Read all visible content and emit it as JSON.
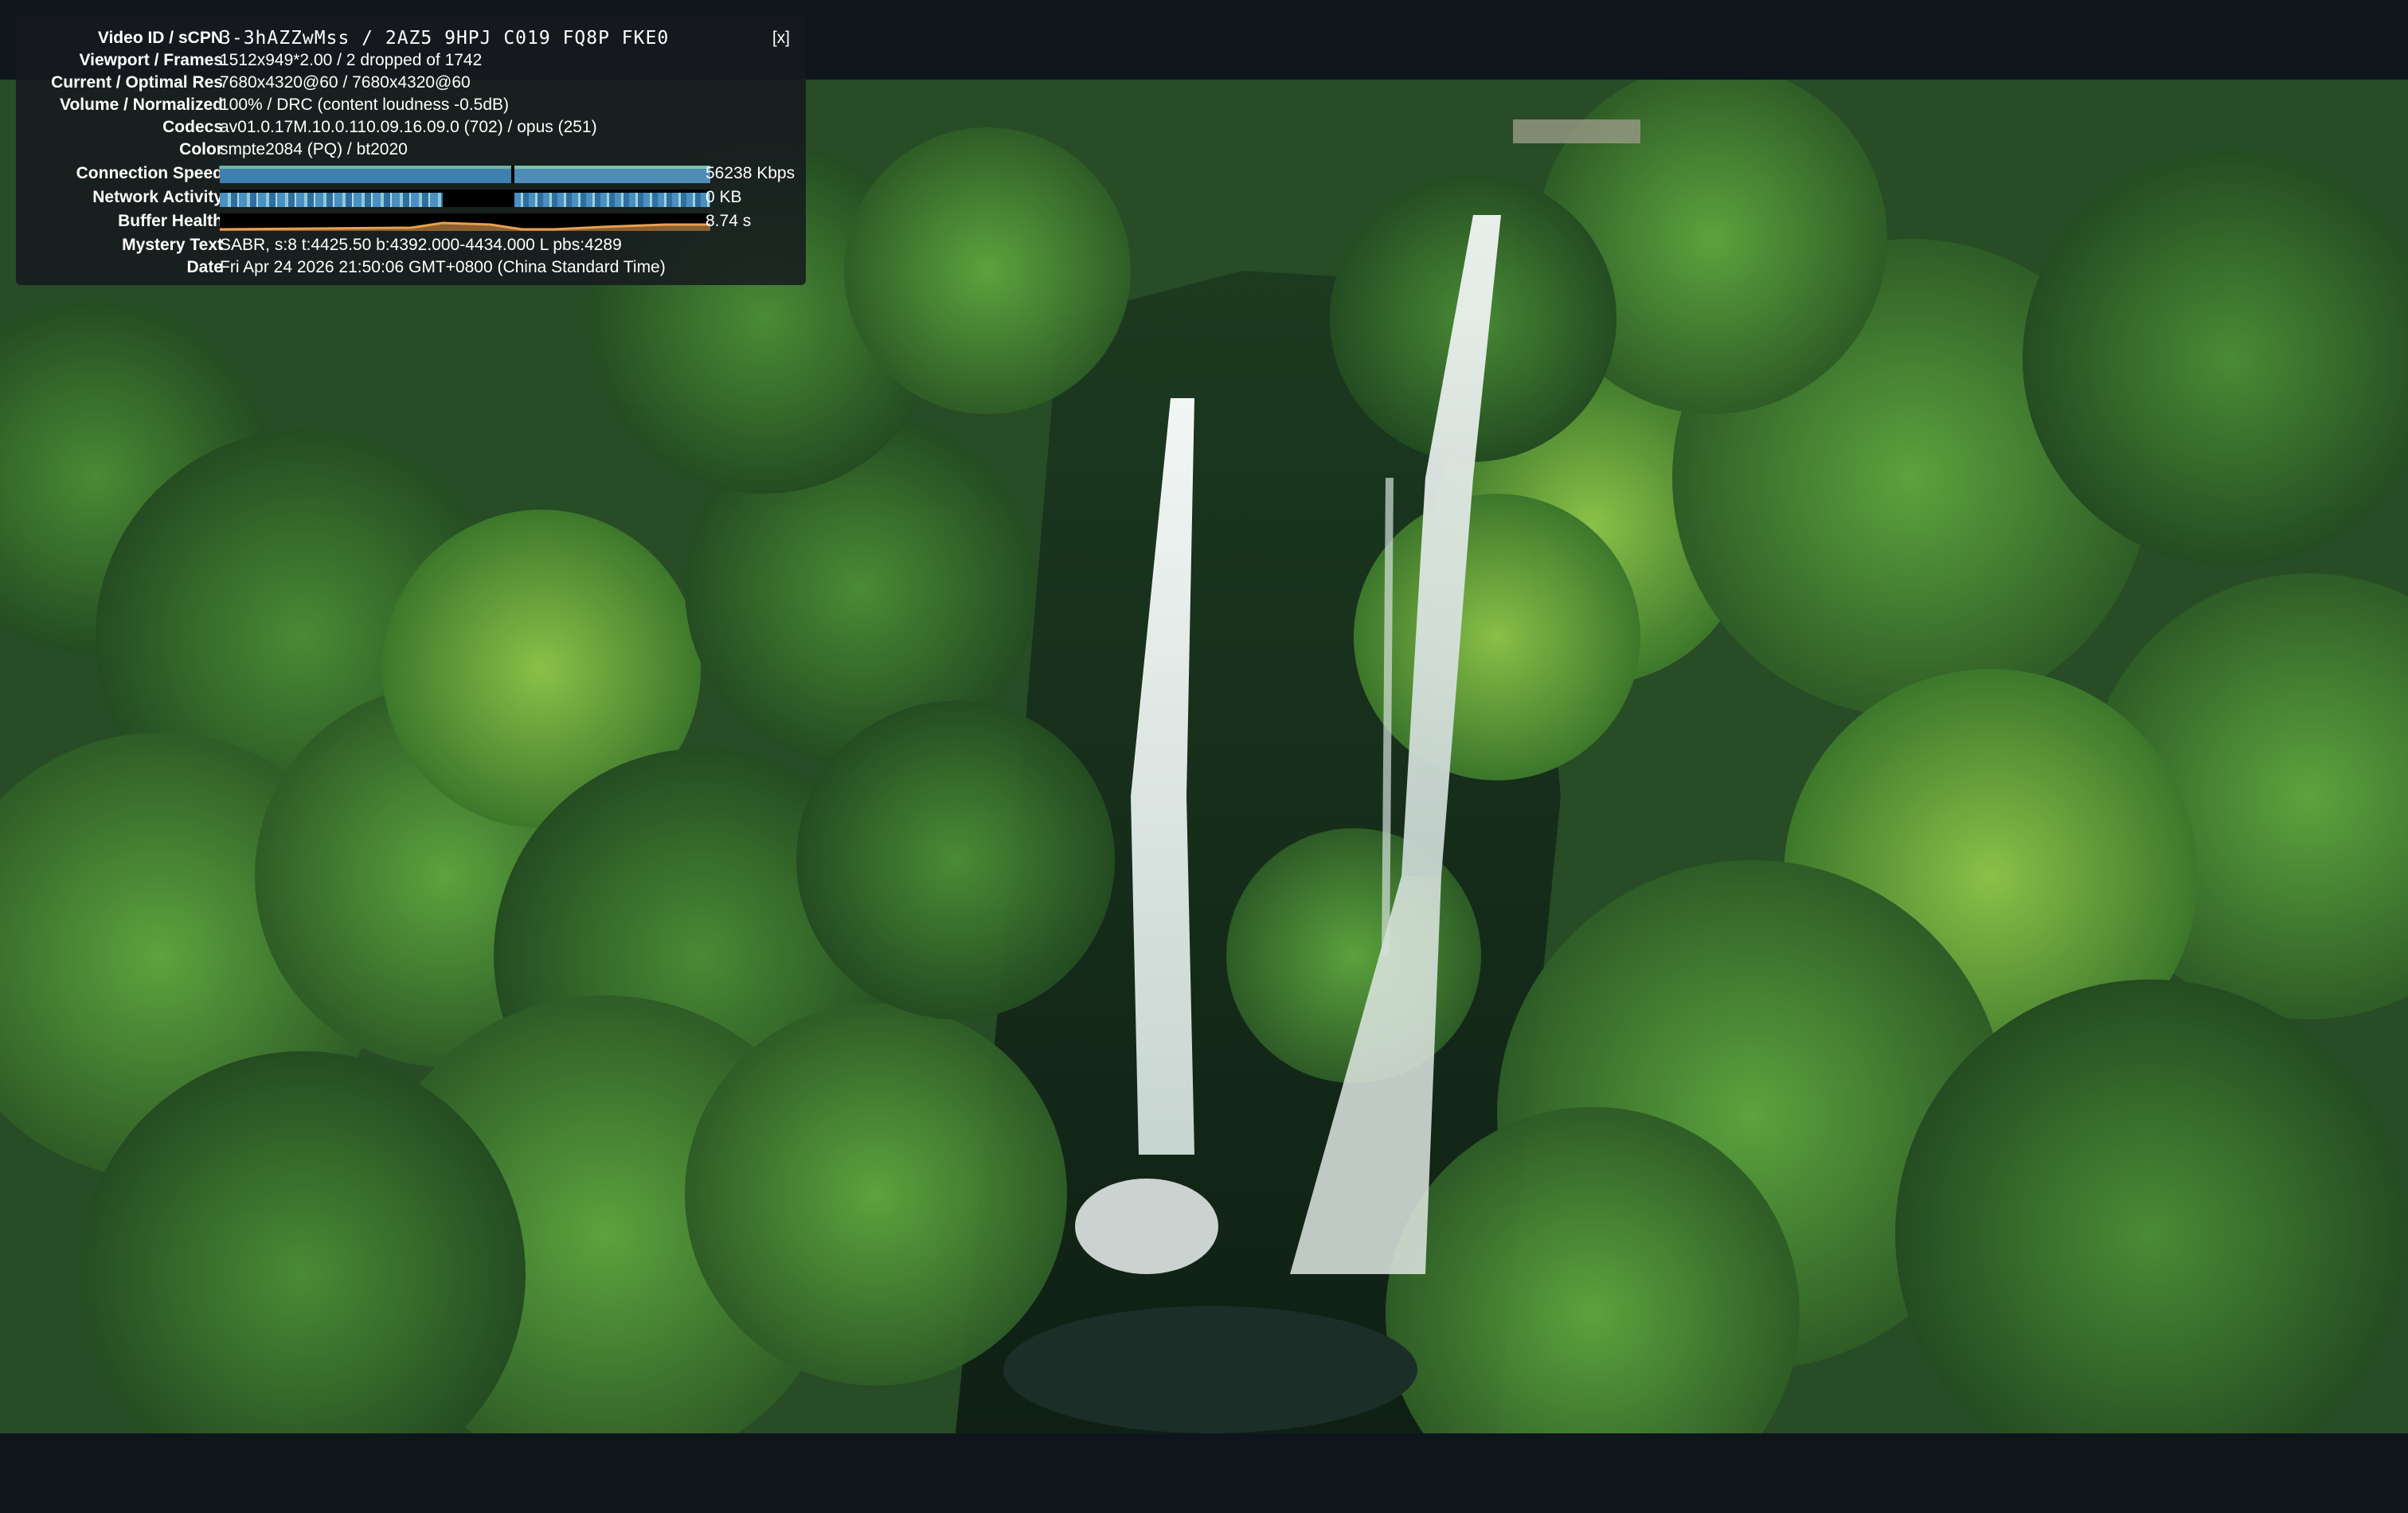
{
  "stats": {
    "close_label": "[x]",
    "rows": [
      {
        "label": "Video ID / sCPN",
        "value": "3-3hAZZwMss / 2AZ5 9HPJ C019 FQ8P FKE0"
      },
      {
        "label": "Viewport / Frames",
        "value": "1512x949*2.00 / 2 dropped of 1742"
      },
      {
        "label": "Current / Optimal Res",
        "value": "7680x4320@60 / 7680x4320@60"
      },
      {
        "label": "Volume / Normalized",
        "value": "100% / DRC (content loudness -0.5dB)"
      },
      {
        "label": "Codecs",
        "value": "av01.0.17M.10.0.110.09.16.09.0 (702) / opus (251)"
      },
      {
        "label": "Color",
        "value": "smpte2084 (PQ) / bt2020"
      },
      {
        "label": "Connection Speed",
        "value": "56238 Kbps"
      },
      {
        "label": "Network Activity",
        "value": "0 KB"
      },
      {
        "label": "Buffer Health",
        "value": "8.74 s"
      },
      {
        "label": "Mystery Text",
        "value": "SABR, s:8 t:4425.50 b:4392.000-4434.000 L pbs:4289"
      },
      {
        "label": "Date",
        "value": "Fri Apr 24 2026 21:50:06 GMT+0800 (China Standard Time)"
      }
    ],
    "colors": {
      "connection_bar": "#3f7fb0",
      "connection_bar_light": "#6fb5a0",
      "network_bar": "#4a90c0",
      "buffer_bar": "#e8a050"
    }
  },
  "video": {
    "scene": "aerial-waterfall-rainforest"
  }
}
